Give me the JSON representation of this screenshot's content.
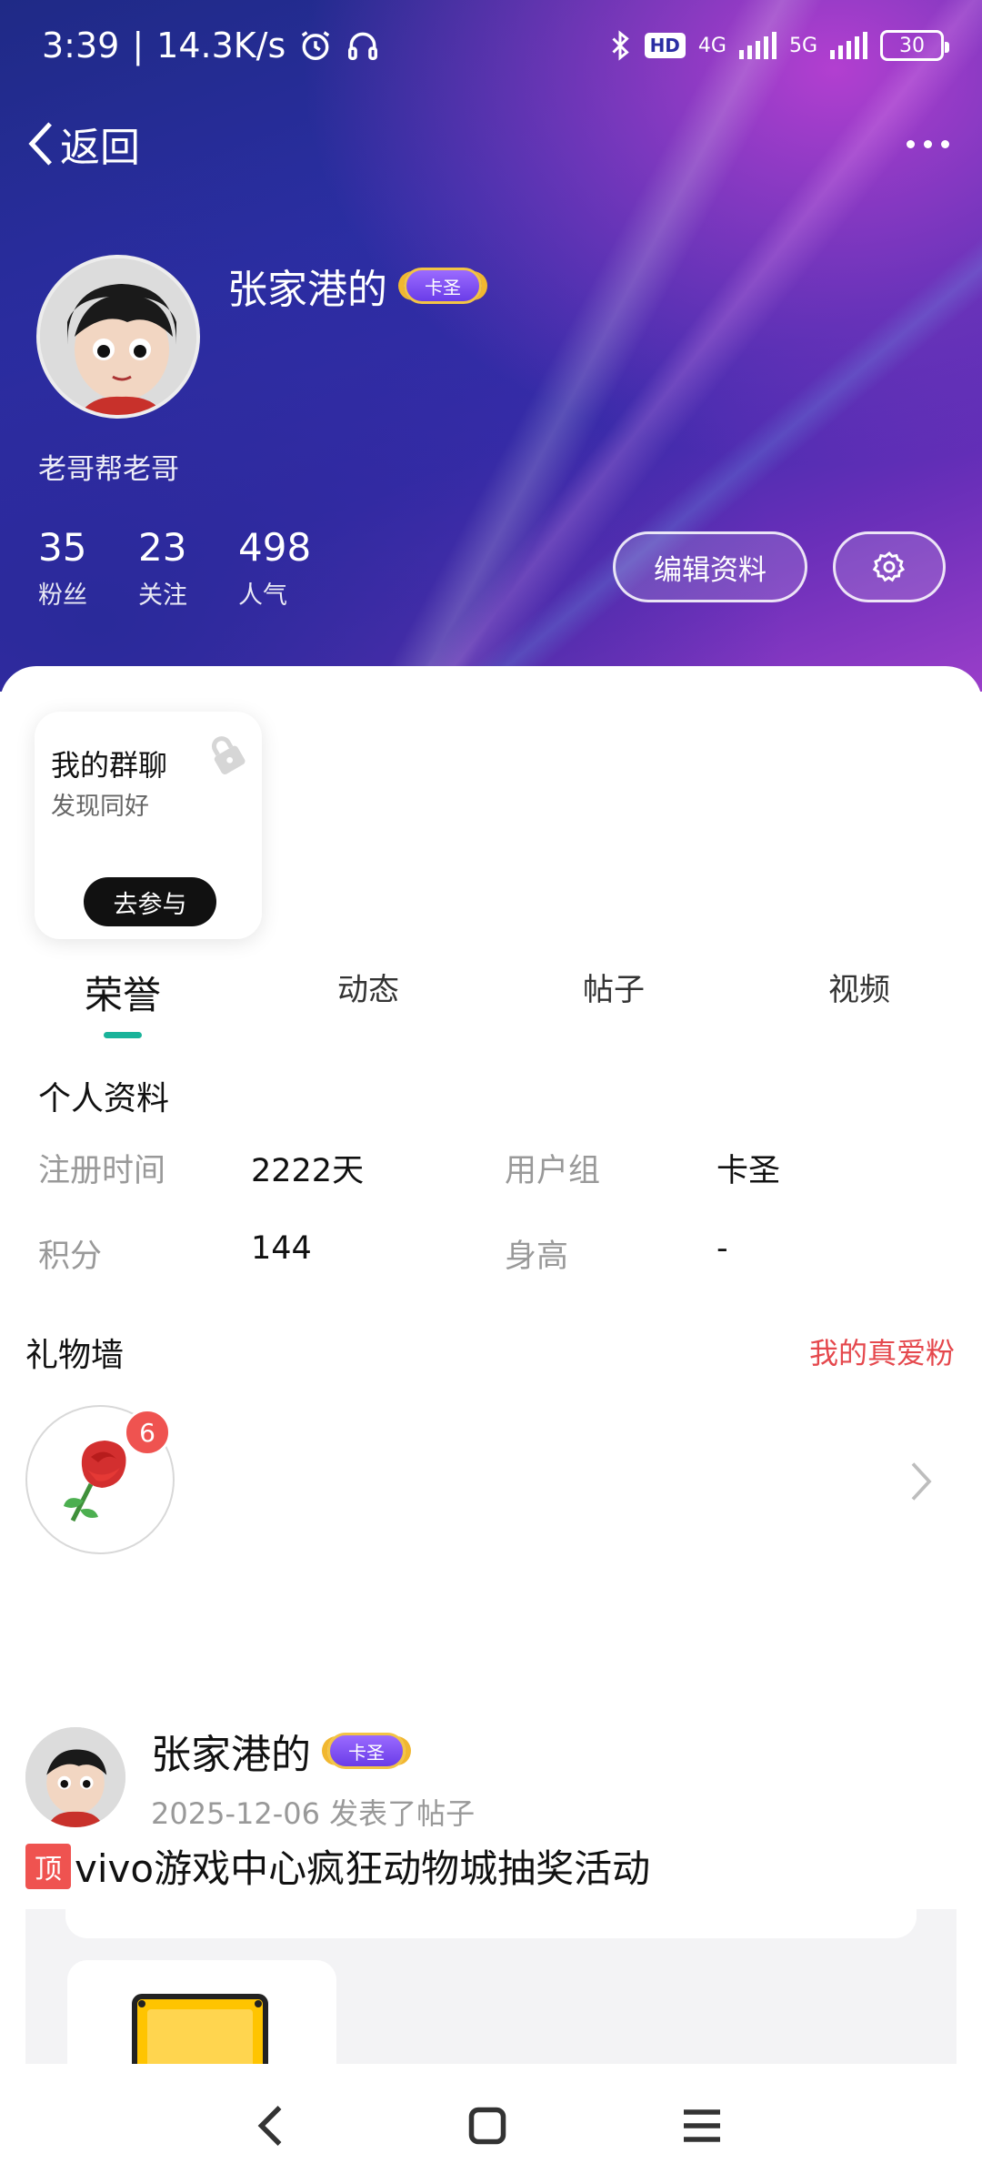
{
  "status_bar": {
    "time": "3:39",
    "separator": "|",
    "speed": "14.3K/s",
    "network_4g": "4G",
    "network_5g": "5G",
    "hd": "HD",
    "battery": "30"
  },
  "nav": {
    "back_label": "返回"
  },
  "profile": {
    "username": "张家港的",
    "badge_label": "卡圣",
    "slogan": "老哥帮老哥",
    "stats": [
      {
        "value": "35",
        "label": "粉丝"
      },
      {
        "value": "23",
        "label": "关注"
      },
      {
        "value": "498",
        "label": "人气"
      }
    ],
    "edit_label": "编辑资料"
  },
  "group_card": {
    "title": "我的群聊",
    "subtitle": "发现同好",
    "join_label": "去参与"
  },
  "tabs": [
    {
      "label": "荣誉",
      "active": true
    },
    {
      "label": "动态",
      "active": false
    },
    {
      "label": "帖子",
      "active": false
    },
    {
      "label": "视频",
      "active": false
    }
  ],
  "personal_info": {
    "title": "个人资料",
    "fields": [
      {
        "label": "注册时间",
        "value": "2222天"
      },
      {
        "label": "用户组",
        "value": "卡圣"
      },
      {
        "label": "积分",
        "value": "144"
      },
      {
        "label": "身高",
        "value": "-"
      }
    ]
  },
  "gift_wall": {
    "title": "礼物墙",
    "link": "我的真爱粉",
    "gift_icon": "rose-icon",
    "count": "6"
  },
  "post": {
    "author": "张家港的",
    "badge_label": "卡圣",
    "date": "2025-12-06",
    "action": "发表了帖子",
    "top_tag": "顶",
    "title": "vivo游戏中心疯狂动物城抽奖活动"
  },
  "colors": {
    "accent": "#19b39a",
    "link_red": "#e5484d",
    "badge_purple": "#7a4cf0"
  }
}
